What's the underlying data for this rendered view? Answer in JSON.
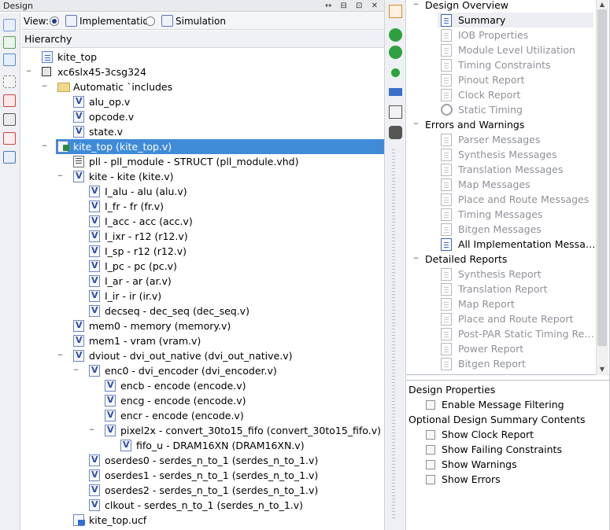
{
  "panel": {
    "title": "Design",
    "window_controls": "↔ ⊟ ⊡ ✕"
  },
  "view_bar": {
    "view_label": "View:",
    "implementation_label": "Implementation",
    "simulation_label": "Simulation",
    "selected": "Implementation"
  },
  "hierarchy_header": "Hierarchy",
  "tree": [
    {
      "label": "kite_top",
      "icon": "document-icon",
      "depth": 0,
      "expander": ""
    },
    {
      "label": "xc6slx45-3csg324",
      "icon": "chip-icon",
      "depth": 0,
      "expander": "−"
    },
    {
      "label": "Automatic `includes",
      "icon": "folder-icon",
      "depth": 1,
      "expander": "−"
    },
    {
      "label": "alu_op.v",
      "icon": "verilog-file-icon",
      "depth": 2,
      "expander": ""
    },
    {
      "label": "opcode.v",
      "icon": "verilog-file-icon",
      "depth": 2,
      "expander": ""
    },
    {
      "label": "state.v",
      "icon": "verilog-file-icon",
      "depth": 2,
      "expander": ""
    },
    {
      "label": "kite_top (kite_top.v)",
      "icon": "top-module-icon",
      "depth": 1,
      "expander": "−",
      "selected": true
    },
    {
      "label": "pll - pll_module - STRUCT (pll_module.vhd)",
      "icon": "vhdl-file-icon",
      "depth": 2,
      "expander": ""
    },
    {
      "label": "kite - kite (kite.v)",
      "icon": "verilog-file-icon",
      "depth": 2,
      "expander": "−"
    },
    {
      "label": "I_alu - alu (alu.v)",
      "icon": "verilog-file-icon",
      "depth": 3,
      "expander": ""
    },
    {
      "label": "I_fr - fr (fr.v)",
      "icon": "verilog-file-icon",
      "depth": 3,
      "expander": ""
    },
    {
      "label": "I_acc - acc (acc.v)",
      "icon": "verilog-file-icon",
      "depth": 3,
      "expander": ""
    },
    {
      "label": "I_ixr - r12 (r12.v)",
      "icon": "verilog-file-icon",
      "depth": 3,
      "expander": ""
    },
    {
      "label": "I_sp - r12 (r12.v)",
      "icon": "verilog-file-icon",
      "depth": 3,
      "expander": ""
    },
    {
      "label": "I_pc - pc (pc.v)",
      "icon": "verilog-file-icon",
      "depth": 3,
      "expander": ""
    },
    {
      "label": "I_ar - ar (ar.v)",
      "icon": "verilog-file-icon",
      "depth": 3,
      "expander": ""
    },
    {
      "label": "I_ir - ir (ir.v)",
      "icon": "verilog-file-icon",
      "depth": 3,
      "expander": ""
    },
    {
      "label": "decseq - dec_seq (dec_seq.v)",
      "icon": "verilog-file-icon",
      "depth": 3,
      "expander": ""
    },
    {
      "label": "mem0 - memory (memory.v)",
      "icon": "verilog-file-icon",
      "depth": 2,
      "expander": ""
    },
    {
      "label": "mem1 - vram (vram.v)",
      "icon": "verilog-file-icon",
      "depth": 2,
      "expander": ""
    },
    {
      "label": "dviout - dvi_out_native (dvi_out_native.v)",
      "icon": "verilog-file-icon",
      "depth": 2,
      "expander": "−"
    },
    {
      "label": "enc0 - dvi_encoder (dvi_encoder.v)",
      "icon": "verilog-file-icon",
      "depth": 3,
      "expander": "−"
    },
    {
      "label": "encb - encode (encode.v)",
      "icon": "verilog-file-icon",
      "depth": 4,
      "expander": ""
    },
    {
      "label": "encg - encode (encode.v)",
      "icon": "verilog-file-icon",
      "depth": 4,
      "expander": ""
    },
    {
      "label": "encr - encode (encode.v)",
      "icon": "verilog-file-icon",
      "depth": 4,
      "expander": ""
    },
    {
      "label": "pixel2x - convert_30to15_fifo (convert_30to15_fifo.v)",
      "icon": "verilog-file-icon",
      "depth": 4,
      "expander": "−"
    },
    {
      "label": "fifo_u - DRAM16XN (DRAM16XN.v)",
      "icon": "verilog-file-icon",
      "depth": 5,
      "expander": ""
    },
    {
      "label": "oserdes0 - serdes_n_to_1 (serdes_n_to_1.v)",
      "icon": "verilog-file-icon",
      "depth": 3,
      "expander": ""
    },
    {
      "label": "oserdes1 - serdes_n_to_1 (serdes_n_to_1.v)",
      "icon": "verilog-file-icon",
      "depth": 3,
      "expander": ""
    },
    {
      "label": "oserdes2 - serdes_n_to_1 (serdes_n_to_1.v)",
      "icon": "verilog-file-icon",
      "depth": 3,
      "expander": ""
    },
    {
      "label": "clkout - serdes_n_to_1 (serdes_n_to_1.v)",
      "icon": "verilog-file-icon",
      "depth": 3,
      "expander": ""
    },
    {
      "label": "kite_top.ucf",
      "icon": "constraints-file-icon",
      "depth": 2,
      "expander": ""
    }
  ],
  "summary_tree": [
    {
      "label": "Design Overview",
      "kind": "section"
    },
    {
      "label": "Summary",
      "kind": "item",
      "active": true
    },
    {
      "label": "IOB Properties",
      "kind": "item"
    },
    {
      "label": "Module Level Utilization",
      "kind": "item"
    },
    {
      "label": "Timing Constraints",
      "kind": "item"
    },
    {
      "label": "Pinout Report",
      "kind": "item"
    },
    {
      "label": "Clock Report",
      "kind": "item"
    },
    {
      "label": "Static Timing",
      "kind": "clock"
    },
    {
      "label": "Errors and Warnings",
      "kind": "section"
    },
    {
      "label": "Parser Messages",
      "kind": "item"
    },
    {
      "label": "Synthesis Messages",
      "kind": "item"
    },
    {
      "label": "Translation Messages",
      "kind": "item"
    },
    {
      "label": "Map Messages",
      "kind": "item"
    },
    {
      "label": "Place and Route Messages",
      "kind": "item"
    },
    {
      "label": "Timing Messages",
      "kind": "item"
    },
    {
      "label": "Bitgen Messages",
      "kind": "item"
    },
    {
      "label": "All Implementation Messa…",
      "kind": "item",
      "active": true
    },
    {
      "label": "Detailed Reports",
      "kind": "section"
    },
    {
      "label": "Synthesis Report",
      "kind": "item"
    },
    {
      "label": "Translation Report",
      "kind": "item"
    },
    {
      "label": "Map Report",
      "kind": "item"
    },
    {
      "label": "Place and Route Report",
      "kind": "item"
    },
    {
      "label": "Post-PAR Static Timing Re…",
      "kind": "item"
    },
    {
      "label": "Power Report",
      "kind": "item"
    },
    {
      "label": "Bitgen Report",
      "kind": "item"
    }
  ],
  "properties": {
    "design_properties": "Design Properties",
    "enable_message_filtering": "Enable Message Filtering",
    "optional_contents": "Optional Design Summary Contents",
    "show_clock_report": "Show Clock Report",
    "show_failing_constraints": "Show Failing Constraints",
    "show_warnings": "Show Warnings",
    "show_errors": "Show Errors"
  },
  "colors": {
    "selection": "#3f8bd8",
    "accent": "#1d3f8a"
  }
}
